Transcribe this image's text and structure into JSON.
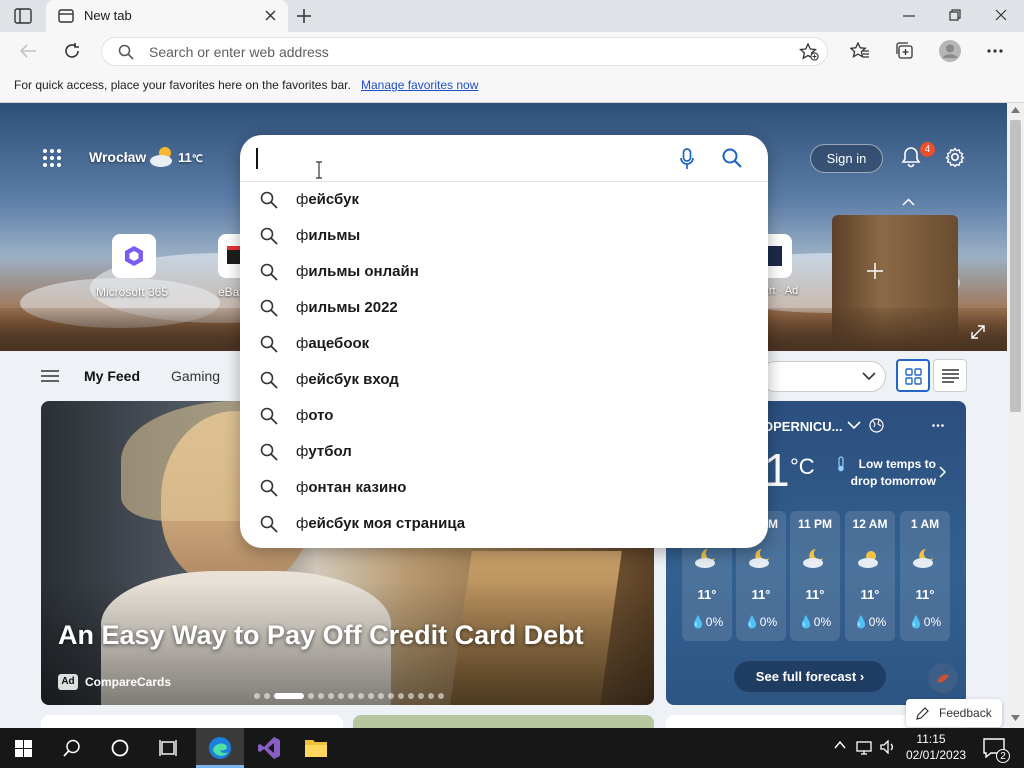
{
  "browser": {
    "tab_title": "New tab",
    "address_placeholder": "Search or enter web address",
    "favorites_bar_message": "For quick access, place your favorites here on the favorites bar.",
    "favorites_bar_link": "Manage favorites now"
  },
  "newtab": {
    "location": "Wrocław",
    "temperature": "11",
    "temperature_unit": "℃",
    "sign_in_label": "Sign in",
    "notification_count": "4",
    "quick_links": [
      {
        "label": "Microsoft 365"
      },
      {
        "label": "eBay"
      },
      {
        "label": "Walmart · Ad"
      }
    ],
    "feed_tabs": [
      "My Feed",
      "Gaming"
    ]
  },
  "search_suggestions": {
    "input_value": "",
    "items": [
      {
        "prefix": "ф",
        "rest": "ейсбук"
      },
      {
        "prefix": "ф",
        "rest": "ильмы"
      },
      {
        "prefix": "ф",
        "rest": "ильмы онлайн"
      },
      {
        "prefix": "ф",
        "rest": "ильмы 2022"
      },
      {
        "prefix": "ф",
        "rest": "ацебоок"
      },
      {
        "prefix": "ф",
        "rest": "ейсбук вход"
      },
      {
        "prefix": "ф",
        "rest": "ото"
      },
      {
        "prefix": "ф",
        "rest": "утбол"
      },
      {
        "prefix": "ф",
        "rest": "онтан казино"
      },
      {
        "prefix": "ф",
        "rest": "ейсбук моя страница"
      }
    ]
  },
  "article": {
    "title": "An Easy Way to Pay Off Credit Card Debt",
    "ad_label": "Ad",
    "source": "CompareCards"
  },
  "weather": {
    "location": "OPERNICU...",
    "current_temp": "1",
    "unit": "°C",
    "alert": "Low temps to drop tomorrow",
    "hours": [
      {
        "hour": "M",
        "temp": "11°",
        "precip": "0%"
      },
      {
        "hour": "M",
        "temp": "11°",
        "precip": "0%"
      },
      {
        "hour": "11 PM",
        "temp": "11°",
        "precip": "0%"
      },
      {
        "hour": "12 AM",
        "temp": "11°",
        "precip": "0%"
      },
      {
        "hour": "1 AM",
        "temp": "11°",
        "precip": "0%"
      }
    ],
    "forecast_button": "See full forecast"
  },
  "feedback_label": "Feedback",
  "taskbar": {
    "time": "11:15",
    "date": "02/01/2023",
    "notification_count": "2"
  },
  "colors": {
    "accent_link": "#1e4fc8",
    "weather_card": "#2b4e7d",
    "taskbar": "#171717",
    "badge": "#e8502e"
  }
}
